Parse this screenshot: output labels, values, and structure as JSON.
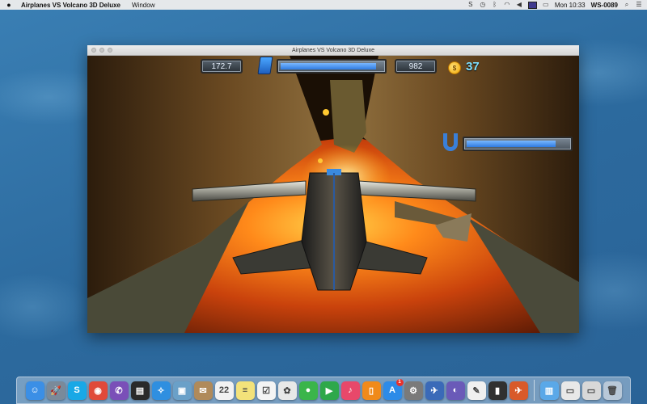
{
  "menubar": {
    "app_name": "Airplanes VS Volcano 3D Deluxe",
    "menus": [
      "Window"
    ],
    "clock": "Mon 10:33",
    "host": "WS-0089"
  },
  "window": {
    "title": "Airplanes VS Volcano 3D Deluxe"
  },
  "hud": {
    "distance": "172.7",
    "score": "982",
    "coins": "37",
    "fuel_level_pct": 97,
    "magnet_level_pct": 90,
    "fuel_icon": "fuel-can-icon",
    "magnet_icon": "magnet-icon",
    "coin_icon": "coin-icon"
  },
  "dock": {
    "apps": [
      {
        "name": "finder",
        "glyph": "☺",
        "color": "#3b8fe6"
      },
      {
        "name": "launchpad",
        "glyph": "🚀",
        "color": "#7a8a9a"
      },
      {
        "name": "skype",
        "glyph": "S",
        "color": "#19a8e6"
      },
      {
        "name": "chrome",
        "glyph": "◉",
        "color": "#e04a3a"
      },
      {
        "name": "viber",
        "glyph": "✆",
        "color": "#7a4fb8"
      },
      {
        "name": "activity-monitor",
        "glyph": "▤",
        "color": "#2a2a2a"
      },
      {
        "name": "safari",
        "glyph": "✧",
        "color": "#2f8fe0"
      },
      {
        "name": "preview",
        "glyph": "▣",
        "color": "#6aa0c8"
      },
      {
        "name": "contacts",
        "glyph": "✉",
        "color": "#b08a5a"
      },
      {
        "name": "calendar",
        "glyph": "22",
        "color": "#f2f2f2"
      },
      {
        "name": "notes",
        "glyph": "≡",
        "color": "#f3e27a"
      },
      {
        "name": "reminders",
        "glyph": "☑",
        "color": "#f4f4f4"
      },
      {
        "name": "photos",
        "glyph": "✿",
        "color": "#e8e8e8"
      },
      {
        "name": "messages",
        "glyph": "●",
        "color": "#3ab54a"
      },
      {
        "name": "facetime",
        "glyph": "▶",
        "color": "#2ea84a"
      },
      {
        "name": "itunes",
        "glyph": "♪",
        "color": "#e8486a"
      },
      {
        "name": "ibooks",
        "glyph": "▯",
        "color": "#f08a1a"
      },
      {
        "name": "app-store",
        "glyph": "A",
        "color": "#2d8be8",
        "badge": "1"
      },
      {
        "name": "system-preferences",
        "glyph": "⚙",
        "color": "#7a7a7a"
      },
      {
        "name": "mail-bird",
        "glyph": "✈",
        "color": "#3a6ab8"
      },
      {
        "name": "wunderbucket",
        "glyph": "◐",
        "color": "#6a5ab8"
      },
      {
        "name": "textedit",
        "glyph": "✎",
        "color": "#f0f0f0"
      },
      {
        "name": "script-editor",
        "glyph": "▮",
        "color": "#303030"
      },
      {
        "name": "airplanes-game",
        "glyph": "✈",
        "color": "#d85a2a"
      }
    ],
    "stacks": [
      {
        "name": "applications-folder",
        "glyph": "▥",
        "color": "#5aa8e8"
      },
      {
        "name": "document-stack",
        "glyph": "▭",
        "color": "#e8e8e8"
      },
      {
        "name": "downloads-stack",
        "glyph": "▭",
        "color": "#d8d8d8"
      },
      {
        "name": "trash",
        "glyph": "🗑",
        "color": "#b8c8d8"
      }
    ]
  }
}
